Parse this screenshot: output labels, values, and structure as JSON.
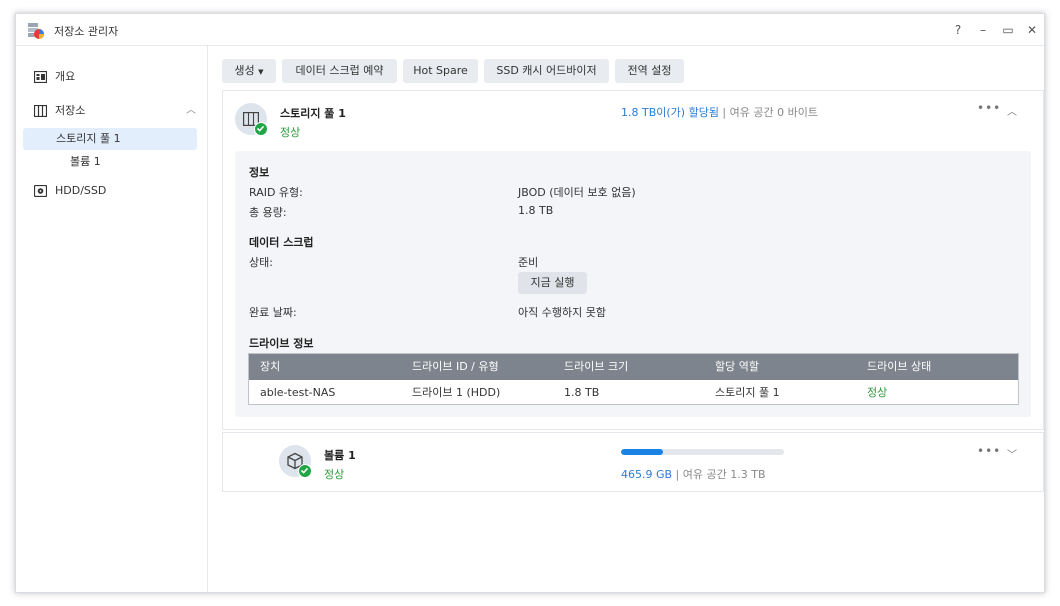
{
  "window": {
    "title": "저장소 관리자",
    "controls": {
      "help": "?",
      "minimize": "–",
      "maximize": "▭",
      "close": "✕"
    }
  },
  "sidebar": {
    "items": [
      {
        "label": "개요",
        "icon": "overview-icon"
      },
      {
        "label": "저장소",
        "icon": "storage-icon",
        "expanded": true
      },
      {
        "label": "HDD/SSD",
        "icon": "hdd-icon"
      }
    ],
    "sub_items": [
      {
        "label": "스토리지 풀 1",
        "active": true
      },
      {
        "label": "볼륨 1",
        "active": false
      }
    ]
  },
  "toolbar": {
    "create": "생성",
    "scrub_schedule": "데이터 스크럽 예약",
    "hot_spare": "Hot Spare",
    "ssd_advisor": "SSD 캐시 어드바이저",
    "global_settings": "전역 설정"
  },
  "pool": {
    "title": "스토리지 풀 1",
    "status": "정상",
    "allocated": "1.8 TB이(가) 할당됨",
    "separator": " | ",
    "free": "여유 공간 0 바이트",
    "info": {
      "heading": "정보",
      "raid_label": "RAID 유형:",
      "raid_value": "JBOD (데이터 보호 없음)",
      "capacity_label": "총 용량:",
      "capacity_value": "1.8 TB"
    },
    "scrub": {
      "heading": "데이터 스크럽",
      "status_label": "상태:",
      "status_value": "준비",
      "run_now": "지금 실행",
      "done_label": "완료 날짜:",
      "done_value": "아직 수행하지 못함"
    },
    "drives": {
      "heading": "드라이브 정보",
      "columns": [
        "장치",
        "드라이브 ID / 유형",
        "드라이브 크기",
        "할당 역할",
        "드라이브 상태"
      ],
      "rows": [
        [
          "able-test-NAS",
          "드라이브 1 (HDD)",
          "1.8 TB",
          "스토리지 풀 1",
          "정상"
        ]
      ]
    }
  },
  "volume": {
    "title": "볼륨 1",
    "status": "정상",
    "used": "465.9 GB",
    "separator": " | ",
    "free": "여유 공간 1.3 TB",
    "usage_fraction": 0.26
  },
  "colors": {
    "accent": "#2b7cd3",
    "ok": "#2e9a3d",
    "badge": "#21a547",
    "progress": "#1a82e3"
  }
}
